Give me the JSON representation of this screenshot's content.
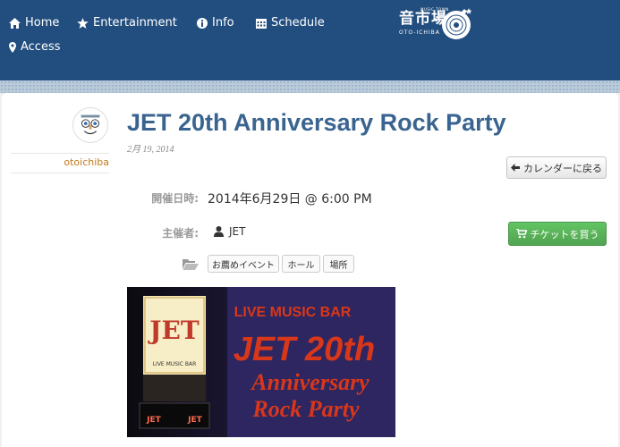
{
  "nav": {
    "home": "Home",
    "entertainment": "Entertainment",
    "info": "Info",
    "schedule": "Schedule",
    "access": "Access"
  },
  "logo": {
    "main": "音市場",
    "sub": "OTO-ICHIBA",
    "tiny": "MUSIC TOWN"
  },
  "post": {
    "author": "otoichiba",
    "title": "JET 20th Anniversary Rock Party",
    "date": "2月 19, 2014"
  },
  "event": {
    "back_label": "カレンダーに戻る",
    "datetime_label": "開催日時:",
    "datetime_value": "2014年6月29日 @ 6:00 PM",
    "organizer_label": "主催者:",
    "organizer_value": "JET",
    "ticket_label": "チケットを買う",
    "tags": [
      "お薦めイベント",
      "ホール",
      "場所"
    ]
  },
  "poster": {
    "bar_label": "LIVE MUSIC BAR",
    "headline": "JET 20th",
    "line2": "Anniversary",
    "line3": "Rock Party",
    "sign_text": "JET",
    "sign_bar": "LIVE MUSIC BAR",
    "neon_left": "JET",
    "neon_right": "JET"
  },
  "colors": {
    "header_bg": "#224e7f",
    "title": "#3a6490",
    "author": "#c17a1a",
    "ticket_button": "#5cb85c",
    "poster_red": "#d9371a",
    "poster_bg": "#2d2660"
  }
}
